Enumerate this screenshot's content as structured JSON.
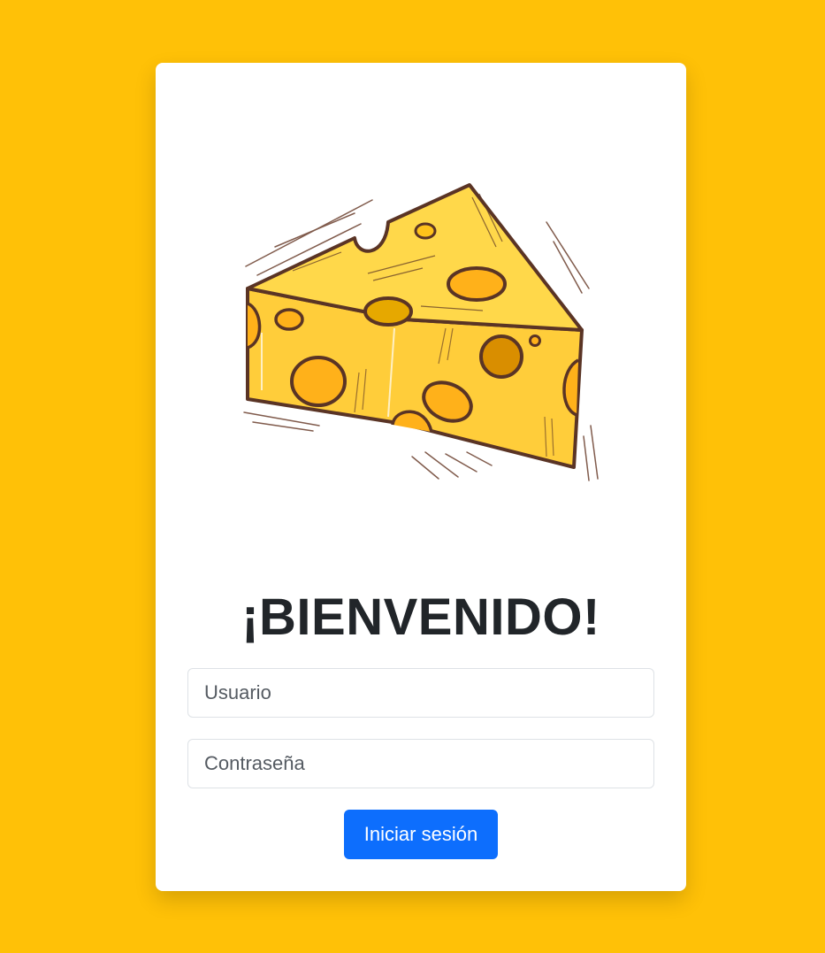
{
  "theme": {
    "background": "#ffc107",
    "card": "#ffffff",
    "primary": "#0d6efd",
    "text": "#212529"
  },
  "hero": {
    "icon": "cheese-illustration"
  },
  "login": {
    "title": "¡BIENVENIDO!",
    "username_placeholder": "Usuario",
    "username_value": "",
    "password_placeholder": "Contraseña",
    "password_value": "",
    "submit_label": "Iniciar sesión"
  }
}
